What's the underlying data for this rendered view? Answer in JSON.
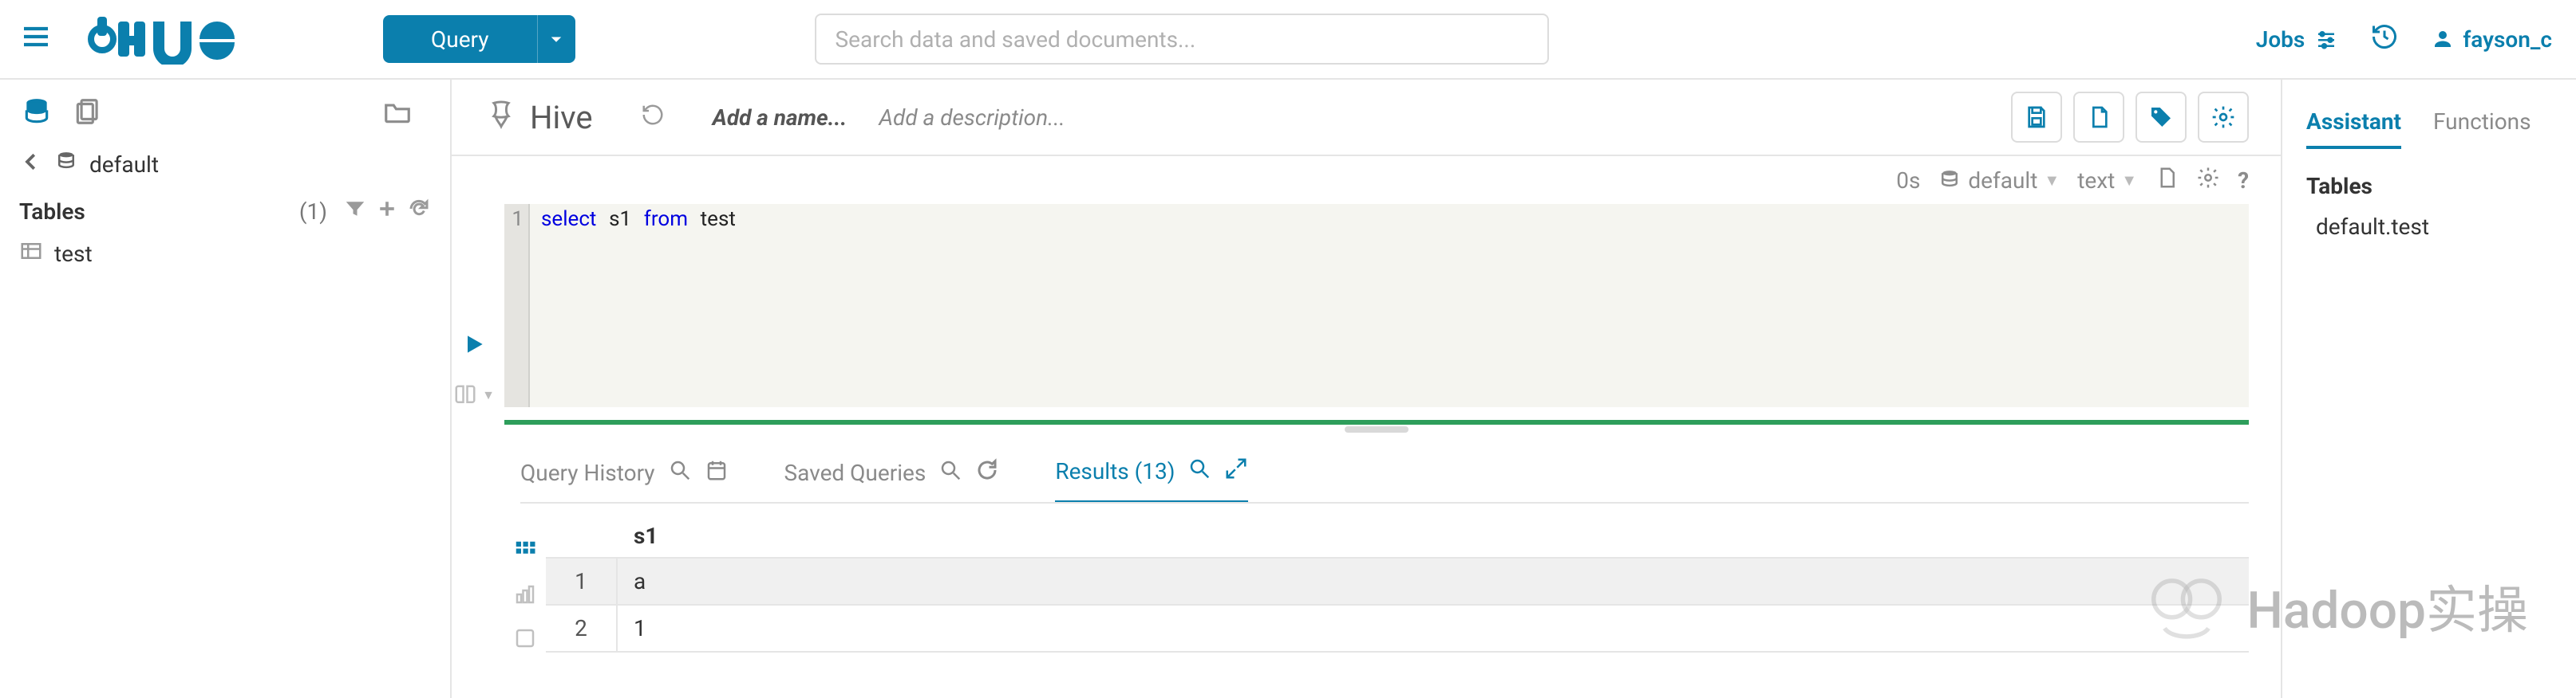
{
  "topnav": {
    "query_label": "Query",
    "search_placeholder": "Search data and saved documents...",
    "jobs_label": "Jobs",
    "username": "fayson_c"
  },
  "sidebar": {
    "breadcrumb_db": "default",
    "tables_label": "Tables",
    "tables_count": "(1)",
    "tables": [
      "test"
    ]
  },
  "editor": {
    "app_name": "Hive",
    "add_name_placeholder": "Add a name...",
    "add_desc_placeholder": "Add a description...",
    "status_time": "0s",
    "status_db": "default",
    "status_format": "text",
    "line_no": "1",
    "sql_kw1": "select",
    "sql_id1": "s1",
    "sql_kw2": "from",
    "sql_id2": "test"
  },
  "tabs": {
    "history": "Query History",
    "saved": "Saved Queries",
    "results": "Results (13)"
  },
  "results": {
    "header": "s1",
    "rows": [
      {
        "idx": "1",
        "val": "a"
      },
      {
        "idx": "2",
        "val": "1"
      }
    ]
  },
  "right": {
    "assistant": "Assistant",
    "functions": "Functions",
    "tables_h": "Tables",
    "table_item": "default.test"
  },
  "watermark": "Hadoop实操"
}
